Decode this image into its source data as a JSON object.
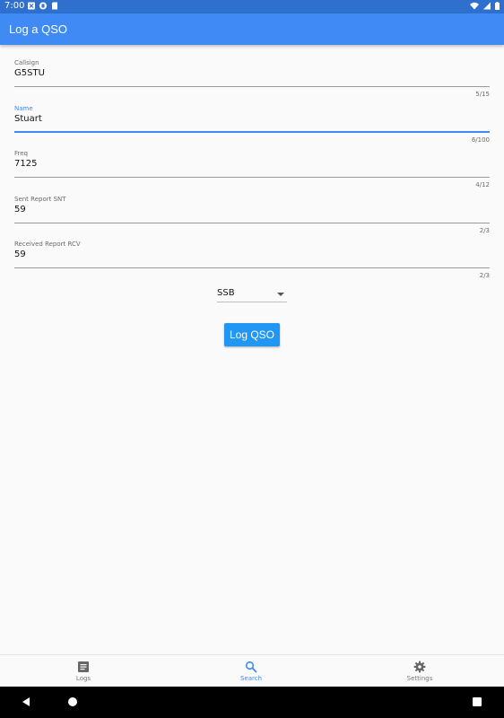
{
  "status_bar": {
    "time": "7:00",
    "color": "#2f6fce"
  },
  "app_bar": {
    "title": "Log a QSO",
    "color": "#3f8af5"
  },
  "form": {
    "fields": [
      {
        "label": "Callsign",
        "value": "G5STU",
        "counter": "5/15"
      },
      {
        "label": "Name",
        "value": "Stuart",
        "counter": "6/100"
      },
      {
        "label": "Freq",
        "value": "7125",
        "counter": "4/12"
      },
      {
        "label": "Sent Report SNT",
        "value": "59",
        "counter": "2/3"
      },
      {
        "label": "Received Report RCV",
        "value": "59",
        "counter": "2/3"
      }
    ],
    "mode": {
      "selected": "SSB"
    },
    "submit_label": "Log QSO"
  },
  "bottom_nav": {
    "items": [
      {
        "label": "Logs",
        "icon": "list-icon"
      },
      {
        "label": "Search",
        "icon": "search-icon"
      },
      {
        "label": "Settings",
        "icon": "gear-icon"
      }
    ],
    "active": "Search"
  }
}
